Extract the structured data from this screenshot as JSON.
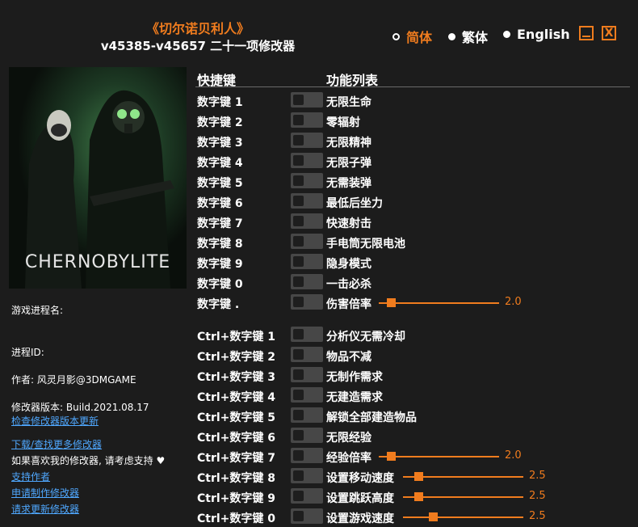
{
  "header": {
    "game_title": "《切尔诺贝利人》",
    "subtitle": "v45385-v45657 二十一项修改器"
  },
  "languages": [
    {
      "label": "简体",
      "selected": true
    },
    {
      "label": "繁体",
      "selected": false
    },
    {
      "label": "English",
      "selected": false
    }
  ],
  "window": {
    "minimize_icon": "minimize-icon",
    "close_label": "X"
  },
  "cover": {
    "logo_text": "CHERNOBYLITE"
  },
  "info": {
    "process_name": "游戏进程名:",
    "process_id": "进程ID:",
    "author": "作者: 风灵月影@3DMGAME",
    "version": "修改器版本: Build.2021.08.17",
    "check_update": "检查修改器版本更新",
    "download_more": "下载/查找更多修改器",
    "support_text": "如果喜欢我的修改器, 请考虑支持 ♥",
    "support_author": "支持作者",
    "request_make": "申请制作修改器",
    "request_update": "请求更新修改器"
  },
  "columns": {
    "hotkey": "快捷键",
    "function": "功能列表"
  },
  "cheats": [
    {
      "key": "数字键 1",
      "name": "无限生命"
    },
    {
      "key": "数字键 2",
      "name": "零辐射"
    },
    {
      "key": "数字键 3",
      "name": "无限精神"
    },
    {
      "key": "数字键 4",
      "name": "无限子弹"
    },
    {
      "key": "数字键 5",
      "name": "无需装弹"
    },
    {
      "key": "数字键 6",
      "name": "最低后坐力"
    },
    {
      "key": "数字键 7",
      "name": "快速射击"
    },
    {
      "key": "数字键 8",
      "name": "手电筒无限电池"
    },
    {
      "key": "数字键 9",
      "name": "隐身模式"
    },
    {
      "key": "数字键 0",
      "name": "一击必杀"
    },
    {
      "key": "数字键 .",
      "name": "伤害倍率",
      "slider": "2.0",
      "level": 0.1
    },
    {
      "key": "Ctrl+数字键 1",
      "name": "分析仪无需冷却"
    },
    {
      "key": "Ctrl+数字键 2",
      "name": "物品不减"
    },
    {
      "key": "Ctrl+数字键 3",
      "name": "无制作需求"
    },
    {
      "key": "Ctrl+数字键 4",
      "name": "无建造需求"
    },
    {
      "key": "Ctrl+数字键 5",
      "name": "解锁全部建造物品"
    },
    {
      "key": "Ctrl+数字键 6",
      "name": "无限经验"
    },
    {
      "key": "Ctrl+数字键 7",
      "name": "经验倍率",
      "slider": "2.0",
      "level": 0.1
    },
    {
      "key": "Ctrl+数字键 8",
      "name": "设置移动速度",
      "slider": "2.5",
      "level": 0.13
    },
    {
      "key": "Ctrl+数字键 9",
      "name": "设置跳跃高度",
      "slider": "2.5",
      "level": 0.13
    },
    {
      "key": "Ctrl+数字键 0",
      "name": "设置游戏速度",
      "slider": "2.5",
      "level": 0.25
    }
  ]
}
